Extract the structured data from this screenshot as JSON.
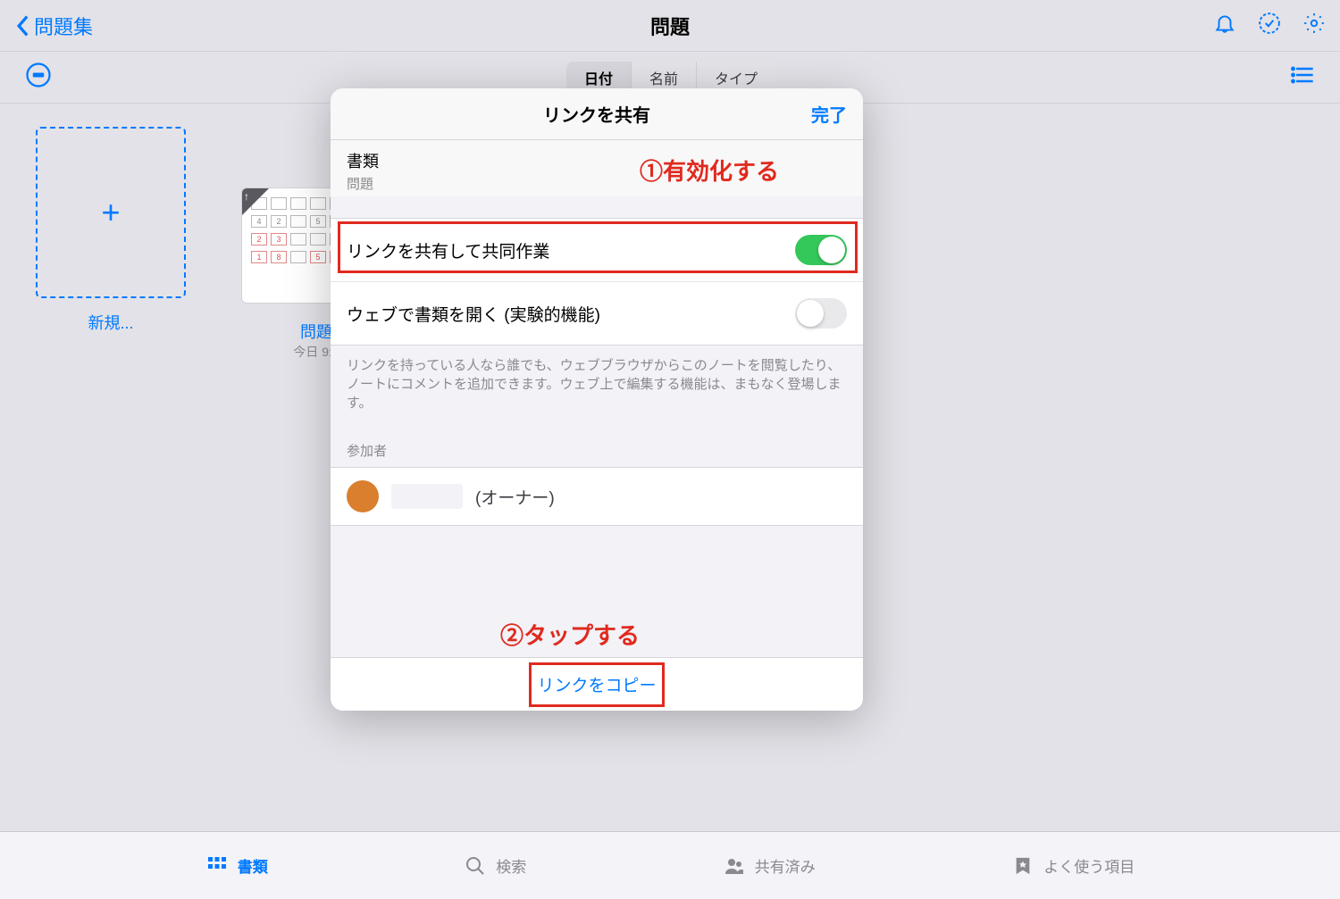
{
  "nav": {
    "back_label": "問題集",
    "title": "問題"
  },
  "sort": {
    "tabs": [
      "日付",
      "名前",
      "タイプ"
    ],
    "selected_index": 0
  },
  "docs": {
    "new_label": "新規...",
    "item": {
      "title": "問題",
      "date": "今日 9:2"
    }
  },
  "modal": {
    "title": "リンクを共有",
    "done": "完了",
    "section_label": "書類",
    "section_sub": "問題",
    "row_share": "リンクを共有して共同作業",
    "row_web": "ウェブで書類を開く (実験的機能)",
    "share_enabled": true,
    "web_enabled": false,
    "footer_text": "リンクを持っている人なら誰でも、ウェブブラウザからこのノートを閲覧したり、ノートにコメントを追加できます。ウェブ上で編集する機能は、まもなく登場します。",
    "members_label": "参加者",
    "owner_role": "(オーナー)",
    "copy_link": "リンクをコピー"
  },
  "annotations": {
    "step1": "①有効化する",
    "step2": "②タップする"
  },
  "tabbar": {
    "documents": "書類",
    "search": "検索",
    "shared": "共有済み",
    "favorites": "よく使う項目"
  }
}
